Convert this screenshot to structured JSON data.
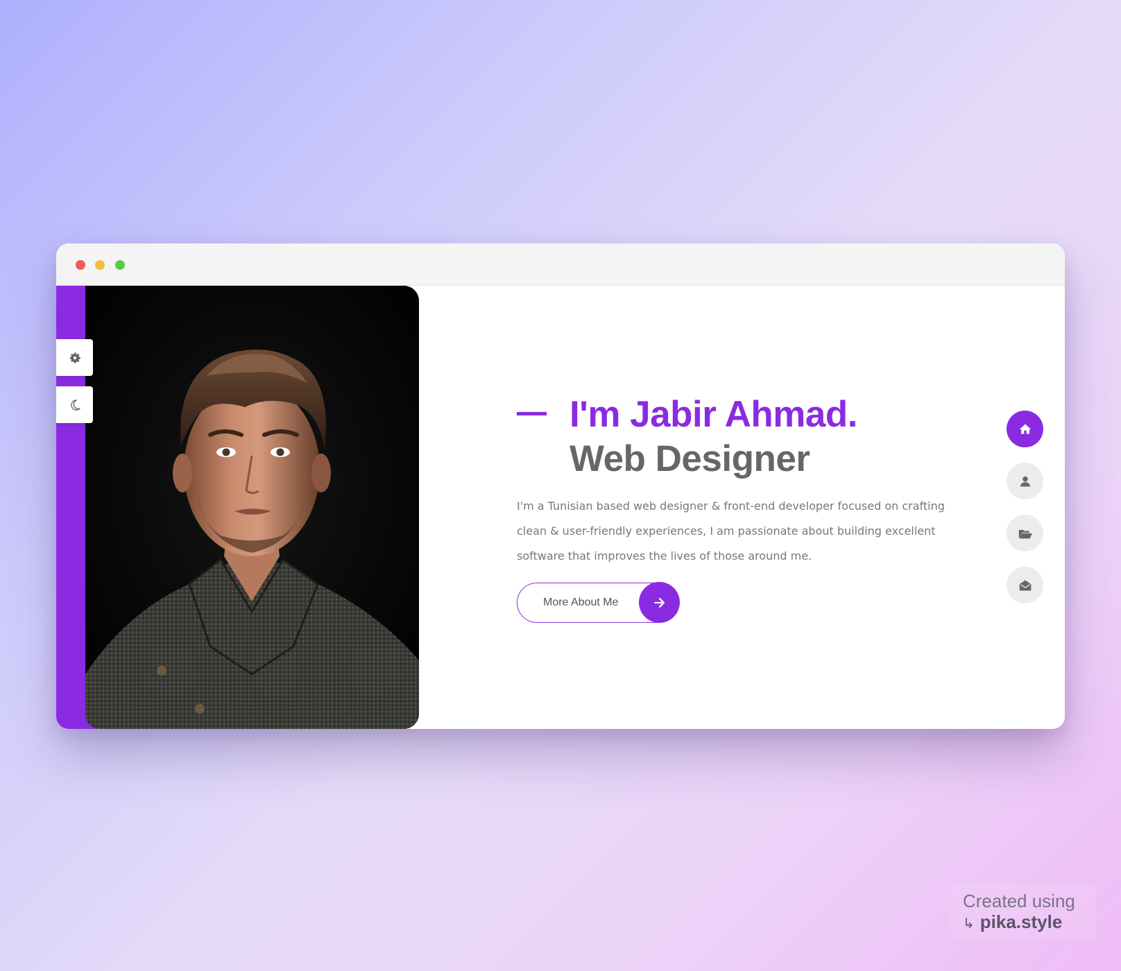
{
  "hero": {
    "name": "I'm Jabir Ahmad.",
    "role": "Web Designer",
    "description": "I'm a Tunisian based web designer & front-end developer focused on crafting clean & user-friendly experiences, I am passionate about building excellent software that improves the lives of those around me.",
    "cta_label": "More About Me",
    "cta_icon": "arrow-right-icon"
  },
  "side_tools": [
    {
      "icon": "gear-icon"
    },
    {
      "icon": "moon-icon"
    }
  ],
  "nav": [
    {
      "icon": "home-icon",
      "active": true
    },
    {
      "icon": "user-icon",
      "active": false
    },
    {
      "icon": "folder-open-icon",
      "active": false
    },
    {
      "icon": "envelope-open-icon",
      "active": false
    }
  ],
  "colors": {
    "accent": "#8a2be2",
    "heading_gray": "#666666",
    "text_gray": "#777777",
    "nav_inactive": "#ececec"
  },
  "watermark": {
    "line1": "Created using",
    "line2": "pika.style"
  }
}
